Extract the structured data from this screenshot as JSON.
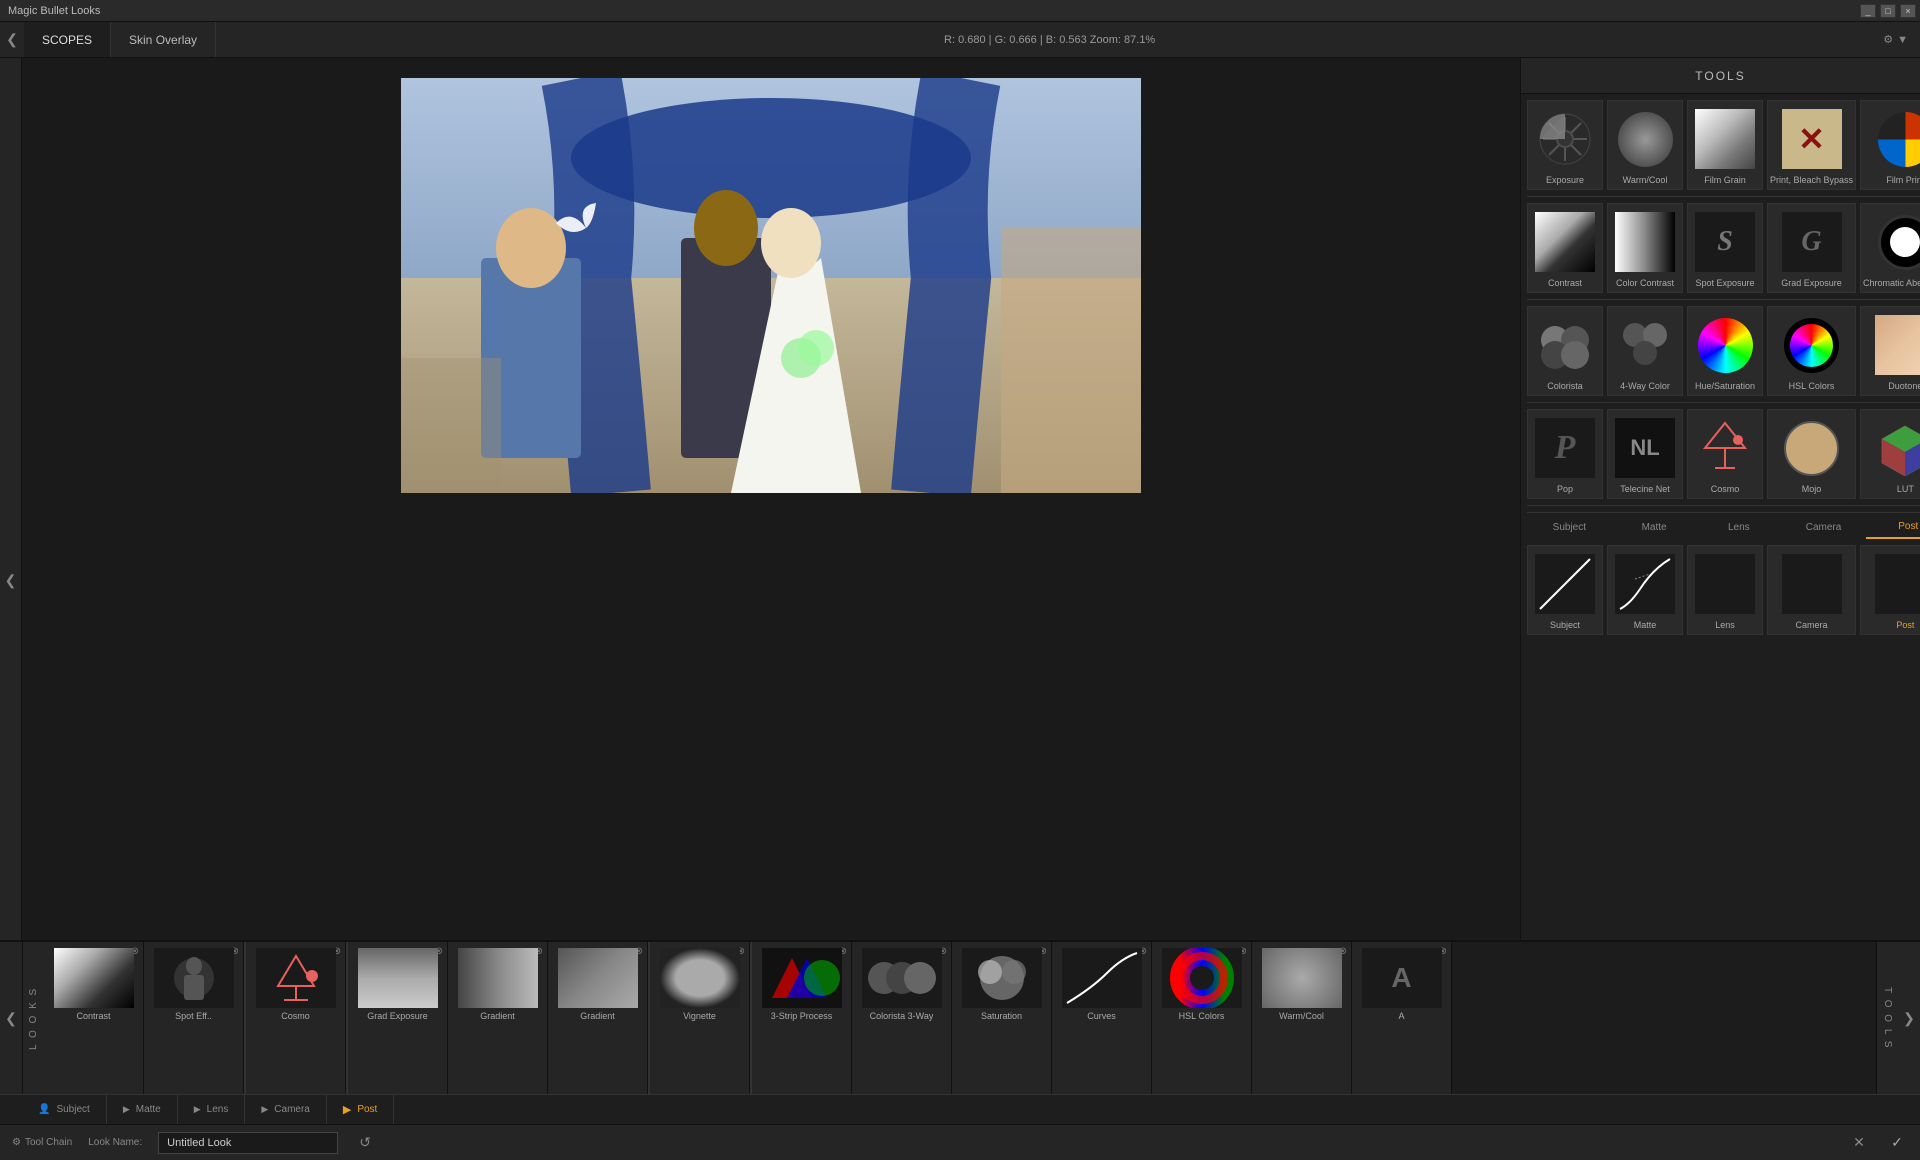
{
  "app": {
    "title": "Magic Bullet Looks",
    "window_controls": [
      "minimize",
      "maximize",
      "close"
    ]
  },
  "title_bar": {
    "title": "Magic Bullet Looks"
  },
  "top_bar": {
    "nav_arrow": "❮",
    "tabs": [
      {
        "label": "SCOPES",
        "active": true
      },
      {
        "label": "Skin Overlay",
        "active": false
      }
    ],
    "info": "R: 0.680  |  G: 0.666  |  B: 0.563    Zoom: 87.1%",
    "settings_icon": "⚙"
  },
  "tools_panel": {
    "title": "TOOLS",
    "rows": [
      {
        "items": [
          {
            "id": "exposure",
            "label": "Exposure",
            "thumb_type": "exposure"
          },
          {
            "id": "warm-cool",
            "label": "Warm/Cool",
            "thumb_type": "warm-cool"
          },
          {
            "id": "film-grain",
            "label": "Film Grain",
            "thumb_type": "film-grain"
          },
          {
            "id": "print-bleach",
            "label": "Print, Bleach Bypass",
            "thumb_type": "print-bleach"
          },
          {
            "id": "film-print",
            "label": "Film Print",
            "thumb_type": "film-print"
          }
        ]
      },
      {
        "items": [
          {
            "id": "contrast",
            "label": "Contrast",
            "thumb_type": "contrast"
          },
          {
            "id": "color-contrast",
            "label": "Color Contrast",
            "thumb_type": "color-contrast"
          },
          {
            "id": "spot-exposure",
            "label": "Spot Exposure",
            "thumb_type": "spot-exposure"
          },
          {
            "id": "grad-exposure",
            "label": "Grad Exposure",
            "thumb_type": "grad-exposure"
          },
          {
            "id": "chromatic",
            "label": "Chromatic Aberration",
            "thumb_type": "chromatic"
          }
        ]
      },
      {
        "items": [
          {
            "id": "colorista",
            "label": "Colorista",
            "thumb_type": "colorista"
          },
          {
            "id": "4way",
            "label": "4-Way Color",
            "thumb_type": "4way"
          },
          {
            "id": "hue-sat",
            "label": "Hue/Saturation",
            "thumb_type": "hue-sat"
          },
          {
            "id": "hsl",
            "label": "HSL Colors",
            "thumb_type": "hsl"
          },
          {
            "id": "duotone",
            "label": "Duotone",
            "thumb_type": "duotone"
          }
        ]
      },
      {
        "items": [
          {
            "id": "pop",
            "label": "Pop",
            "thumb_type": "pop"
          },
          {
            "id": "telecine",
            "label": "Telecine Net",
            "thumb_type": "telecine"
          },
          {
            "id": "cosmo",
            "label": "Cosmo",
            "thumb_type": "cosmo"
          },
          {
            "id": "mojo",
            "label": "Mojo",
            "thumb_type": "mojo"
          },
          {
            "id": "lut",
            "label": "LUT",
            "thumb_type": "lut"
          }
        ]
      },
      {
        "items": [
          {
            "id": "subject-tool",
            "label": "Subject",
            "thumb_type": "subject-curve"
          },
          {
            "id": "matte-tool",
            "label": "Matte",
            "thumb_type": "matte-curve"
          },
          {
            "id": "lens-tool",
            "label": "Lens",
            "thumb_type": "lens-empty"
          },
          {
            "id": "camera-tool",
            "label": "Camera",
            "thumb_type": "camera-empty"
          },
          {
            "id": "post-tool",
            "label": "Post",
            "thumb_type": "post-empty",
            "label_color": "post"
          }
        ]
      }
    ],
    "section_tabs": [
      {
        "label": "Subject",
        "active": false
      },
      {
        "label": "Matte",
        "active": false
      },
      {
        "label": "Lens",
        "active": false
      },
      {
        "label": "Camera",
        "active": false
      },
      {
        "label": "Post",
        "active": true
      }
    ]
  },
  "bottom_panel": {
    "nav_arrow_left": "❮",
    "nav_arrow_right": "❯",
    "looks_label": "L O O K S",
    "tools_label": "T O O L S",
    "strip_items": [
      {
        "label": "Contrast",
        "thumb_type": "contrast-strip",
        "section": "subject",
        "closable": true,
        "enabled": true
      },
      {
        "label": "Spot Eff..",
        "thumb_type": "spot-strip",
        "section": "subject",
        "closable": true,
        "enabled": true
      },
      {
        "label": "Cosmo",
        "thumb_type": "cosmo-strip",
        "section": "matte",
        "closable": true,
        "enabled": true
      },
      {
        "label": "Grad Exposure",
        "thumb_type": "grad-strip",
        "section": "lens",
        "closable": true,
        "enabled": true
      },
      {
        "label": "Gradient",
        "thumb_type": "gradient-strip",
        "section": "lens",
        "closable": true,
        "enabled": true
      },
      {
        "label": "Gradient",
        "thumb_type": "gradient2-strip",
        "section": "lens",
        "closable": true,
        "enabled": true
      },
      {
        "label": "Vignette",
        "thumb_type": "vignette-strip",
        "section": "camera",
        "closable": true,
        "enabled": true
      },
      {
        "label": "3-Strip Process",
        "thumb_type": "3strip-strip",
        "section": "post",
        "closable": true,
        "enabled": true
      },
      {
        "label": "Colorista 3-Way",
        "thumb_type": "colorista3-strip",
        "section": "post",
        "closable": true,
        "enabled": true
      },
      {
        "label": "Saturation",
        "thumb_type": "saturation-strip",
        "section": "post",
        "closable": true,
        "enabled": true
      },
      {
        "label": "Curves",
        "thumb_type": "curves-strip",
        "section": "post",
        "closable": true,
        "enabled": true
      },
      {
        "label": "HSL Colors",
        "thumb_type": "hsl-strip",
        "section": "post",
        "closable": true,
        "enabled": true
      },
      {
        "label": "Warm/Cool",
        "thumb_type": "warm-strip",
        "section": "post",
        "closable": true,
        "enabled": true
      },
      {
        "label": "A",
        "thumb_type": "a-strip",
        "section": "post",
        "closable": true,
        "enabled": true
      }
    ],
    "section_labels": [
      {
        "label": "Subject",
        "icon": "👤",
        "active": false
      },
      {
        "label": "Matte",
        "icon": "▶",
        "active": false
      },
      {
        "label": "Lens",
        "icon": "▶",
        "active": false
      },
      {
        "label": "Camera",
        "icon": "▶",
        "active": false
      },
      {
        "label": "Post",
        "icon": "▶",
        "active": true
      }
    ],
    "tool_chain": {
      "label": "Tool Chain",
      "look_name_label": "Look Name:",
      "look_name_value": "Untitled Look",
      "reset_icon": "↺",
      "cancel_icon": "✕",
      "confirm_icon": "✓"
    }
  }
}
